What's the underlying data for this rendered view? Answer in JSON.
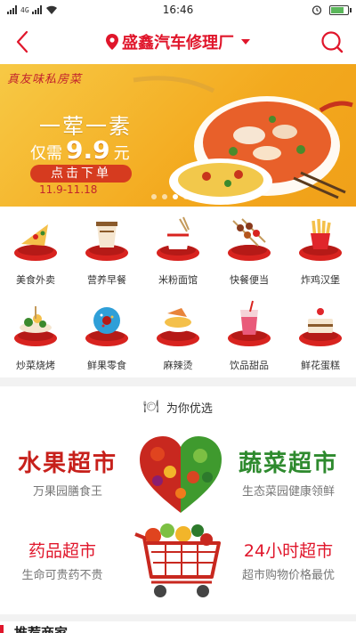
{
  "status": {
    "network": "4G",
    "time": "16:46",
    "battery_level": 0.8
  },
  "header": {
    "location": "盛鑫汽车修理厂",
    "accent": "#e0162b"
  },
  "banner": {
    "tag": "真友味私房菜",
    "title": "一荤一素",
    "price_prefix": "仅需",
    "price": "9.9",
    "price_unit": "元",
    "button": "点击下单",
    "date": "11.9-11.18",
    "page_count": 4,
    "active_page": 3
  },
  "categories": [
    {
      "label": "美食外卖",
      "icon": "pizza-icon"
    },
    {
      "label": "营养早餐",
      "icon": "coffee-cup-icon"
    },
    {
      "label": "米粉面馆",
      "icon": "noodle-box-icon"
    },
    {
      "label": "快餐便当",
      "icon": "skewer-icon"
    },
    {
      "label": "炸鸡汉堡",
      "icon": "fries-icon"
    },
    {
      "label": "炒菜烧烤",
      "icon": "bbq-icon"
    },
    {
      "label": "鲜果零食",
      "icon": "donut-icon"
    },
    {
      "label": "麻辣烫",
      "icon": "hotpot-icon"
    },
    {
      "label": "饮品甜品",
      "icon": "drink-icon"
    },
    {
      "label": "鲜花蛋糕",
      "icon": "cake-icon"
    }
  ],
  "section": {
    "icon": "cutlery-icon",
    "title": "为你优选"
  },
  "markets": {
    "fruit": {
      "title": "水果超市",
      "subtitle": "万果园膳食王"
    },
    "veg": {
      "title": "蔬菜超市",
      "subtitle": "生态菜园健康领鲜"
    },
    "drug": {
      "title": "药品超市",
      "subtitle": "生命可贵药不贵"
    },
    "h24": {
      "title": "24小时超市",
      "subtitle": "超市购物价格最优"
    }
  },
  "bottom": {
    "title": "推荐商家"
  }
}
